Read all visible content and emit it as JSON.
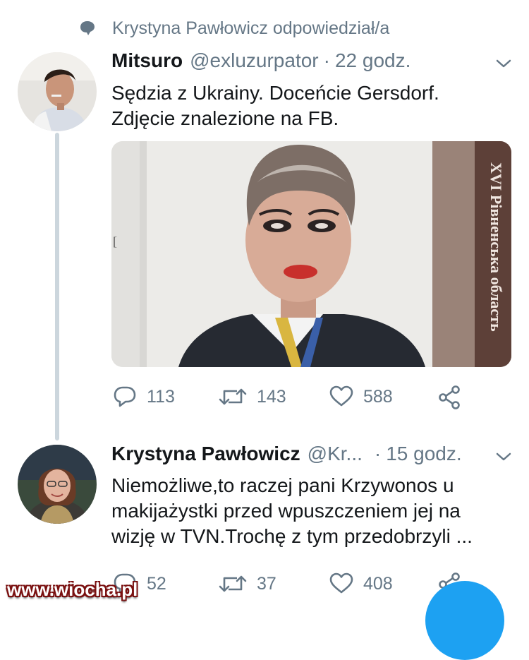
{
  "context": {
    "text": "Krystyna Pawłowicz odpowiedział/a",
    "icon": "speech-bubble-icon"
  },
  "tweet1": {
    "name": "Mitsuro",
    "handle": "@exluzurpator",
    "dot": "·",
    "time": "22 godz.",
    "lines": [
      "Sędzia z Ukrainy. Doceńcie Gersdorf.",
      "Zdjęcie znalezione na FB."
    ],
    "media": {
      "side_text": "XVI Рівненська область",
      "bracket": "["
    },
    "reply_count": "113",
    "retweet_count": "143",
    "like_count": "588"
  },
  "tweet2": {
    "name": "Krystyna Pawłowicz",
    "handle": "@Kr...",
    "dot": "·",
    "time": "15 godz.",
    "lines": [
      "Niemożliwe,to raczej pani Krzywonos u",
      "makijażystki  przed wpuszczeniem jej na",
      "wizję w TVN.Trochę z tym przedobrzyli ..."
    ],
    "reply_count": "52",
    "retweet_count": "37",
    "like_count": "408"
  },
  "watermark": "www.wiocha.pl",
  "colors": {
    "text": "#14171a",
    "secondary": "#657786",
    "thread": "#ccd6dd",
    "accent": "#1da1f2"
  }
}
